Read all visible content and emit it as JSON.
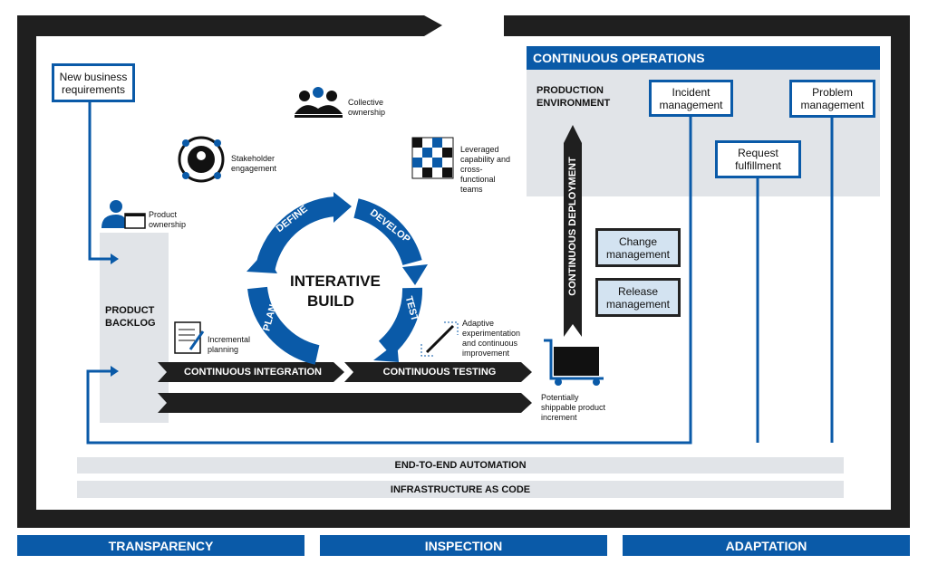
{
  "colors": {
    "blue": "#0a5aa8",
    "black": "#1f1f1f",
    "gray": "#e1e4e8",
    "light_blue": "#d3e3f1"
  },
  "new_business": "New business requirements",
  "product_ownership": "Product ownership",
  "stakeholder": "Stakeholder engagement",
  "collective": "Collective ownership",
  "leveraged": "Leveraged capability and cross-functional teams",
  "incremental": "Incremental planning",
  "adaptive": "Adaptive experimentation and continuous improvement",
  "shippable": "Potentially shippable product increment",
  "product_backlog": "PRODUCT BACKLOG",
  "cycle": {
    "title": "INTERATIVE BUILD",
    "define": "DEFINE",
    "develop": "DEVELOP",
    "test": "TEST",
    "plan": "PLAN"
  },
  "ci": "CONTINUOUS INTEGRATION",
  "ct": "CONTINUOUS TESTING",
  "cd": "CONTINUOUS DEPLOYMENT",
  "ops": {
    "title": "CONTINUOUS OPERATIONS",
    "env": "PRODUCTION ENVIRONMENT",
    "incident": "Incident management",
    "problem": "Problem management",
    "request": "Request fulfillment",
    "change": "Change management",
    "release": "Release management"
  },
  "automation": "END-TO-END AUTOMATION",
  "iac": "INFRASTRUCTURE AS CODE",
  "pillars": [
    "TRANSPARENCY",
    "INSPECTION",
    "ADAPTATION"
  ]
}
